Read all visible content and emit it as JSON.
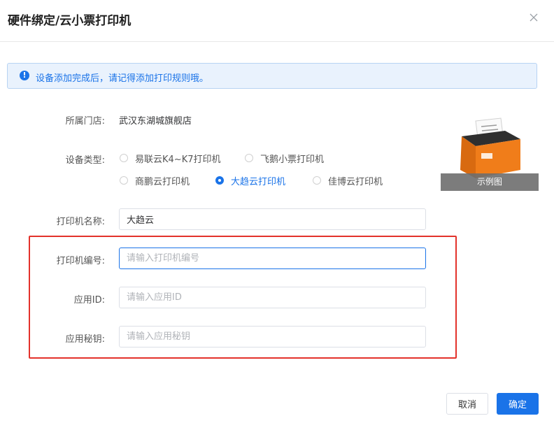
{
  "dialog": {
    "title": "硬件绑定/云小票打印机",
    "close_icon": "close-icon"
  },
  "alert": {
    "icon": "info-icon",
    "icon_glyph": "!",
    "text": "设备添加完成后，请记得添加打印规则哦。"
  },
  "form": {
    "store_label": "所属门店:",
    "store_value": "武汉东湖城旗舰店",
    "device_type_label": "设备类型:",
    "device_types": [
      {
        "label": "易联云K4~K7打印机",
        "checked": false
      },
      {
        "label": "飞鹅小票打印机",
        "checked": false
      },
      {
        "label": "商鹏云打印机",
        "checked": false
      },
      {
        "label": "大趋云打印机",
        "checked": true
      },
      {
        "label": "佳博云打印机",
        "checked": false
      }
    ],
    "printer_name_label": "打印机名称:",
    "printer_name_value": "大趋云",
    "printer_number_label": "打印机编号:",
    "printer_number_placeholder": "请输入打印机编号",
    "app_id_label": "应用ID:",
    "app_id_placeholder": "请输入应用ID",
    "app_secret_label": "应用秘钥:",
    "app_secret_placeholder": "请输入应用秘钥"
  },
  "example": {
    "caption": "示例图"
  },
  "footer": {
    "cancel_label": "取消",
    "ok_label": "确定"
  },
  "colors": {
    "accent": "#1a73e8",
    "highlight": "#e3322b",
    "printer_body": "#f07d1a"
  }
}
